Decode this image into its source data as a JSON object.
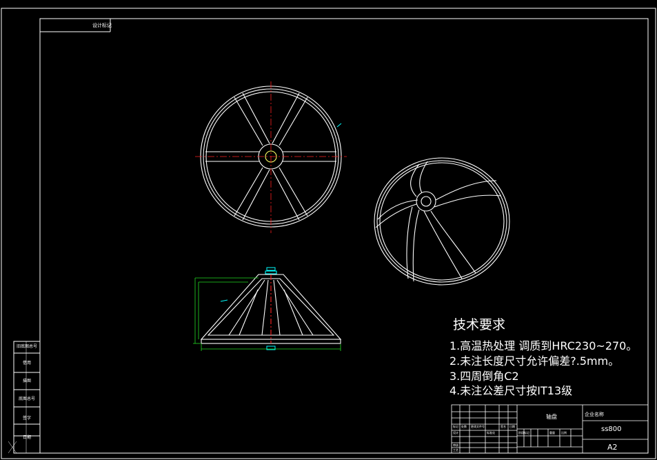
{
  "drawing": {
    "header_label": "设计标记",
    "tech_requirements_title": "技术要求",
    "notes": [
      "1.高温热处理  调质到HRC230~270。",
      "2.未注长度尺寸允许偏差?.5mm。",
      "3.四周倒角C2",
      "4.未注公差尺寸按IT13级"
    ],
    "title_block": {
      "part_name": "轴盘",
      "material": "企业名称",
      "drawing_no": "ss800",
      "sheet_size": "A2",
      "rev_labels": [
        "标记",
        "处数",
        "更改文件号",
        "签名",
        "日期"
      ],
      "role_labels": [
        "设计",
        "审核",
        "工艺"
      ],
      "std_label": "标准化",
      "stage_labels": [
        "阶段标记",
        "重量",
        "比例"
      ]
    },
    "side_labels": [
      "旧底图总号",
      "借用",
      "描图",
      "底图总号",
      "签字",
      "日期"
    ]
  },
  "colors": {
    "line": "#ffffff",
    "centerline": "#ff2020",
    "dimension": "#22dd22",
    "annotation": "#00ffff",
    "hub": "#ffff66"
  }
}
